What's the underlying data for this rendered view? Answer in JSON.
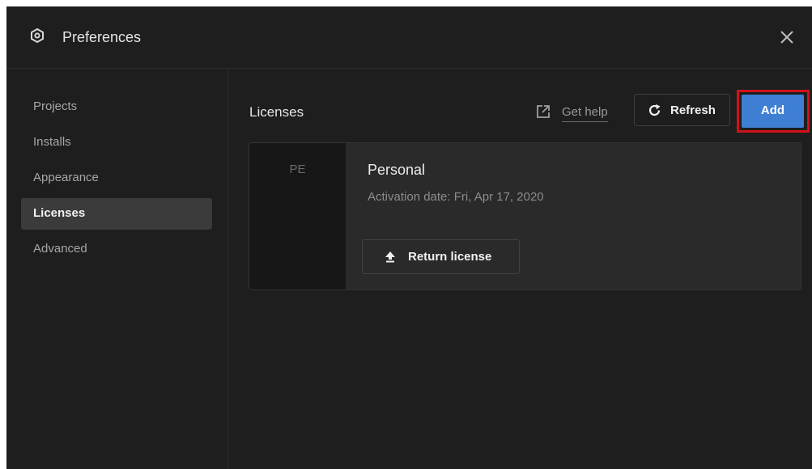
{
  "window": {
    "title": "Preferences",
    "title_icon": "gear-icon",
    "close_icon": "close-icon"
  },
  "sidebar": {
    "items": [
      {
        "label": "Projects",
        "active": false
      },
      {
        "label": "Installs",
        "active": false
      },
      {
        "label": "Appearance",
        "active": false
      },
      {
        "label": "Licenses",
        "active": true
      },
      {
        "label": "Advanced",
        "active": false
      }
    ]
  },
  "main": {
    "section_title": "Licenses",
    "get_help": {
      "label": "Get help",
      "icon": "external-link-icon"
    },
    "refresh": {
      "label": "Refresh",
      "icon": "refresh-icon"
    },
    "add": {
      "label": "Add"
    },
    "license": {
      "abbr": "PE",
      "name": "Personal",
      "activation": "Activation date: Fri, Apr 17, 2020",
      "return_label": "Return license",
      "return_icon": "upload-arrow-icon"
    }
  },
  "colors": {
    "background": "#1e1e1e",
    "accent": "#3f7fd3",
    "highlight": "#d0121b",
    "active_item": "#3b3b3b"
  }
}
